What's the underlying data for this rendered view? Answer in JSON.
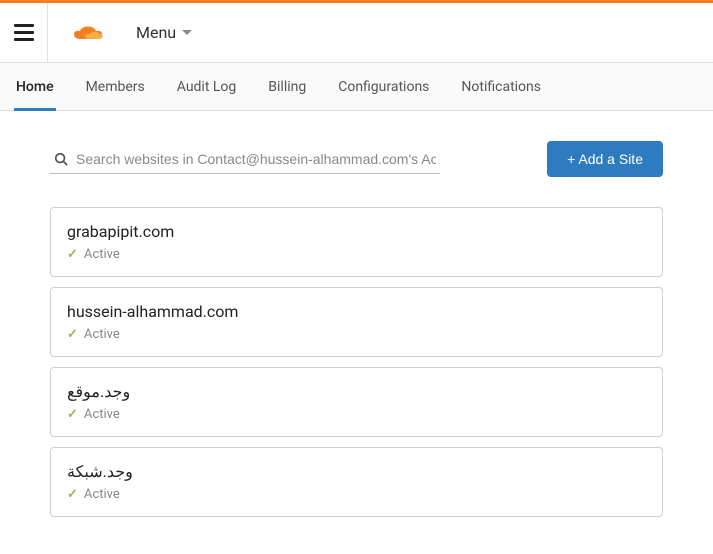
{
  "header": {
    "menu_label": "Menu"
  },
  "nav": {
    "items": [
      {
        "label": "Home",
        "active": true
      },
      {
        "label": "Members",
        "active": false
      },
      {
        "label": "Audit Log",
        "active": false
      },
      {
        "label": "Billing",
        "active": false
      },
      {
        "label": "Configurations",
        "active": false
      },
      {
        "label": "Notifications",
        "active": false
      }
    ]
  },
  "toolbar": {
    "search_placeholder": "Search websites in Contact@hussein-alhammad.com's Acco",
    "add_site_label": "+ Add a Site"
  },
  "sites": [
    {
      "name": "grabapipit.com",
      "status": "Active"
    },
    {
      "name": "hussein-alhammad.com",
      "status": "Active"
    },
    {
      "name": "وجد.موقع",
      "status": "Active"
    },
    {
      "name": "وجد.شبكة",
      "status": "Active"
    }
  ]
}
